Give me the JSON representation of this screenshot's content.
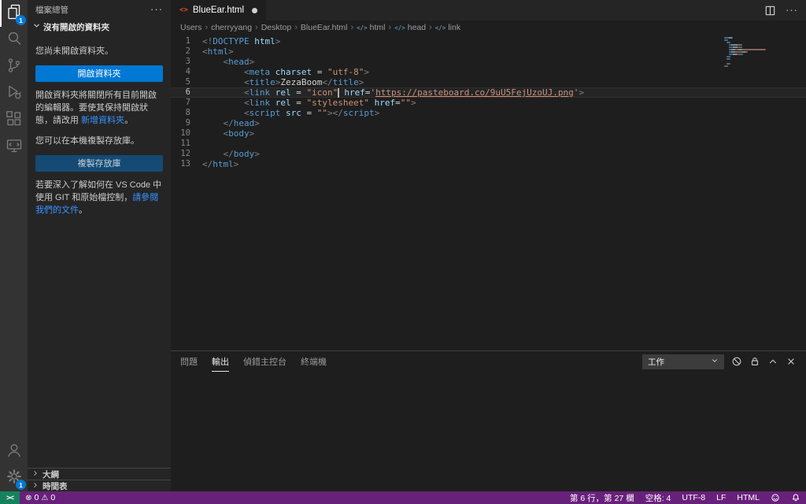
{
  "colors": {
    "accent_blue": "#0078d4",
    "link_blue": "#3794ff",
    "status_bar_bg": "#68217a",
    "remote_indicator_bg": "#16825d",
    "tag_blue": "#569cd6",
    "attr_blue": "#9cdcfe",
    "string_orange": "#ce9178"
  },
  "activity_bar": {
    "items": [
      {
        "id": "explorer",
        "badge": "1",
        "active": true
      },
      {
        "id": "search"
      },
      {
        "id": "source-control"
      },
      {
        "id": "run-debug"
      },
      {
        "id": "extensions"
      },
      {
        "id": "remote-explorer"
      }
    ],
    "bottom": [
      {
        "id": "account"
      },
      {
        "id": "settings",
        "badge": "1"
      }
    ]
  },
  "sidebar": {
    "title": "檔案總管",
    "more_actions": "···",
    "section": "沒有開啟的資料夾",
    "empty_text": "您尚未開啟資料夾。",
    "open_folder_button": "開啟資料夾",
    "note_before_link": "開啟資料夾將關閉所有目前開啟的編輯器。要使其保持開啟狀態，請改用",
    "add_folder_link": "新增資料夾",
    "note_after_link": "。",
    "clone_text": "您可以在本機複製存放庫。",
    "clone_button": "複製存放庫",
    "git_before_link": "若要深入了解如何在 VS Code 中使用 GIT 和原始檔控制，",
    "git_link": "請參閱我們的文件",
    "git_after_link": "。",
    "outline_section": "大綱",
    "timeline_section": "時間表"
  },
  "editor": {
    "tab": {
      "label": "BlueEar.html",
      "modified": true
    },
    "breadcrumbs": [
      {
        "label": "Users"
      },
      {
        "label": "cherryyang"
      },
      {
        "label": "Desktop"
      },
      {
        "label": "BlueEar.html"
      },
      {
        "label": "html",
        "symbol": true
      },
      {
        "label": "head",
        "symbol": true
      },
      {
        "label": "link",
        "symbol": true
      }
    ],
    "code_lines": [
      {
        "tokens": [
          [
            "pn",
            "<!"
          ],
          [
            "tg",
            "DOCTYPE"
          ],
          [
            "at",
            " html"
          ],
          [
            "pn",
            ">"
          ]
        ]
      },
      {
        "tokens": [
          [
            "pn",
            "<"
          ],
          [
            "tg",
            "html"
          ],
          [
            "pn",
            ">"
          ]
        ]
      },
      {
        "tokens": [
          [
            "df",
            "    "
          ],
          [
            "pn",
            "<"
          ],
          [
            "tg",
            "head"
          ],
          [
            "pn",
            ">"
          ]
        ]
      },
      {
        "tokens": [
          [
            "df",
            "        "
          ],
          [
            "pn",
            "<"
          ],
          [
            "tg",
            "meta"
          ],
          [
            "at",
            " charset"
          ],
          [
            "df",
            " = "
          ],
          [
            "st",
            "\"utf-8\""
          ],
          [
            "pn",
            ">"
          ]
        ]
      },
      {
        "tokens": [
          [
            "df",
            "        "
          ],
          [
            "pn",
            "<"
          ],
          [
            "tg",
            "title"
          ],
          [
            "pn",
            ">"
          ],
          [
            "tx",
            "ZezaBoom"
          ],
          [
            "pn",
            "</"
          ],
          [
            "tg",
            "title"
          ],
          [
            "pn",
            ">"
          ]
        ]
      },
      {
        "current": true,
        "tokens": [
          [
            "df",
            "        "
          ],
          [
            "pn",
            "<"
          ],
          [
            "tg",
            "link"
          ],
          [
            "at",
            " rel"
          ],
          [
            "df",
            " = "
          ],
          [
            "st",
            "\"icon\""
          ],
          [
            "cur",
            ""
          ],
          [
            "at",
            " href"
          ],
          [
            "df",
            "="
          ],
          [
            "st",
            "'"
          ],
          [
            "lk",
            "https://pasteboard.co/9uU5FejUzoUJ.png"
          ],
          [
            "st",
            "'"
          ],
          [
            "pn",
            ">"
          ]
        ]
      },
      {
        "tokens": [
          [
            "df",
            "        "
          ],
          [
            "pn",
            "<"
          ],
          [
            "tg",
            "link"
          ],
          [
            "at",
            " rel"
          ],
          [
            "df",
            " = "
          ],
          [
            "st",
            "\"stylesheet\""
          ],
          [
            "at",
            " href"
          ],
          [
            "df",
            "="
          ],
          [
            "st",
            "\"\""
          ],
          [
            "pn",
            ">"
          ]
        ]
      },
      {
        "tokens": [
          [
            "df",
            "        "
          ],
          [
            "pn",
            "<"
          ],
          [
            "tg",
            "script"
          ],
          [
            "at",
            " src"
          ],
          [
            "df",
            " = "
          ],
          [
            "st",
            "\"\""
          ],
          [
            "pn",
            "></"
          ],
          [
            "tg",
            "script"
          ],
          [
            "pn",
            ">"
          ]
        ]
      },
      {
        "tokens": [
          [
            "df",
            "    "
          ],
          [
            "pn",
            "</"
          ],
          [
            "tg",
            "head"
          ],
          [
            "pn",
            ">"
          ]
        ]
      },
      {
        "tokens": [
          [
            "df",
            "    "
          ],
          [
            "pn",
            "<"
          ],
          [
            "tg",
            "body"
          ],
          [
            "pn",
            ">"
          ]
        ]
      },
      {
        "tokens": []
      },
      {
        "tokens": [
          [
            "df",
            "    "
          ],
          [
            "pn",
            "</"
          ],
          [
            "tg",
            "body"
          ],
          [
            "pn",
            ">"
          ]
        ]
      },
      {
        "tokens": [
          [
            "pn",
            "</"
          ],
          [
            "tg",
            "html"
          ],
          [
            "pn",
            ">"
          ]
        ]
      }
    ]
  },
  "panel": {
    "tabs": [
      {
        "label": "問題"
      },
      {
        "label": "輸出",
        "active": true
      },
      {
        "label": "偵錯主控台"
      },
      {
        "label": "終端機"
      }
    ],
    "channel_select": "工作"
  },
  "status_bar": {
    "remote_label": "><",
    "errors": "0",
    "warnings": "0",
    "line_col": "第 6 行，第 27 欄",
    "indent": "空格: 4",
    "encoding": "UTF-8",
    "eol": "LF",
    "language": "HTML"
  }
}
